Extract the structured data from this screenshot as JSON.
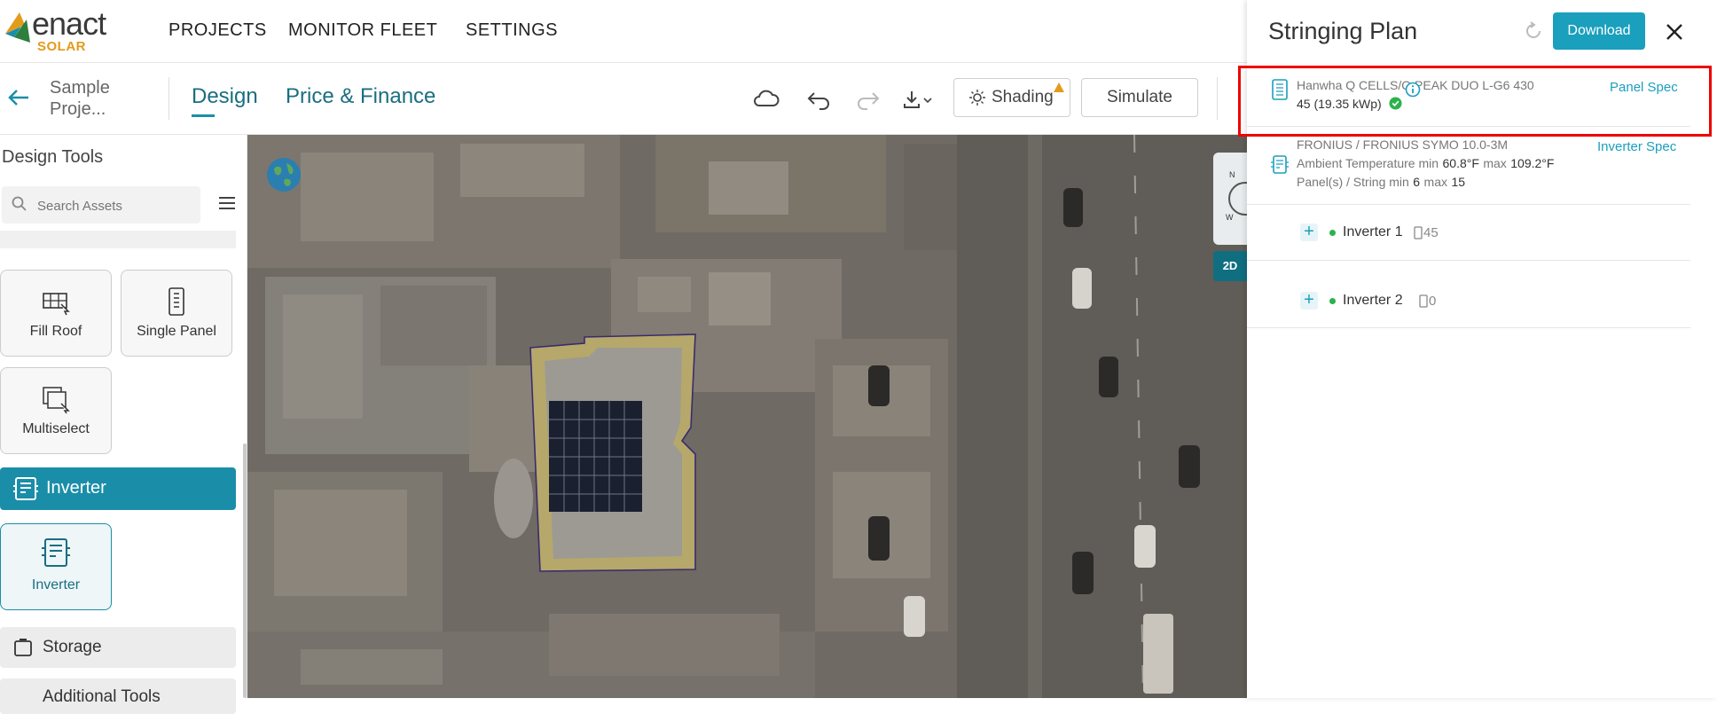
{
  "brand": {
    "name": "enact",
    "sub": "SOLAR"
  },
  "nav": {
    "projects": "PROJECTS",
    "monitor": "MONITOR FLEET",
    "settings": "SETTINGS"
  },
  "subbar": {
    "project_name": "Sample Proje...",
    "tab_design": "Design",
    "tab_price": "Price & Finance",
    "shading_label": "Shading",
    "simulate_label": "Simulate"
  },
  "sidebar": {
    "title": "Design Tools",
    "search_placeholder": "Search Assets",
    "tools": [
      {
        "label": "Fill Roof",
        "icon": "fill-roof-icon"
      },
      {
        "label": "Single Panel",
        "icon": "single-panel-icon"
      },
      {
        "label": "Multiselect",
        "icon": "multiselect-icon"
      }
    ],
    "inverter_section": "Inverter",
    "inverter_tool": "Inverter",
    "storage_section": "Storage",
    "additional_tools": "Additional Tools"
  },
  "map": {
    "view_toggle": "2D"
  },
  "stringing": {
    "title": "Stringing Plan",
    "download_label": "Download",
    "panel": {
      "model": "Hanwha Q CELLS/Q.PEAK DUO L-G6 430",
      "count_summary": "45 (19.35 kWp)",
      "spec_link": "Panel Spec"
    },
    "inverter": {
      "model": "FRONIUS / FRONIUS SYMO 10.0-3M",
      "temp_prefix": "Ambient Temperature min",
      "temp_min": "60.8°F",
      "temp_max_label": "max",
      "temp_max": "109.2°F",
      "panels_prefix": "Panel(s) / String min",
      "panels_min": "6",
      "panels_max_label": "max",
      "panels_max": "15",
      "spec_link": "Inverter Spec"
    },
    "inverters": [
      {
        "name": "Inverter 1",
        "count": "45"
      },
      {
        "name": "Inverter 2",
        "count": "0"
      }
    ]
  },
  "colors": {
    "accent": "#1a9fbd",
    "accent_dark": "#1a8ea8",
    "brand_orange": "#e39b1b",
    "highlight": "#ee0000"
  }
}
